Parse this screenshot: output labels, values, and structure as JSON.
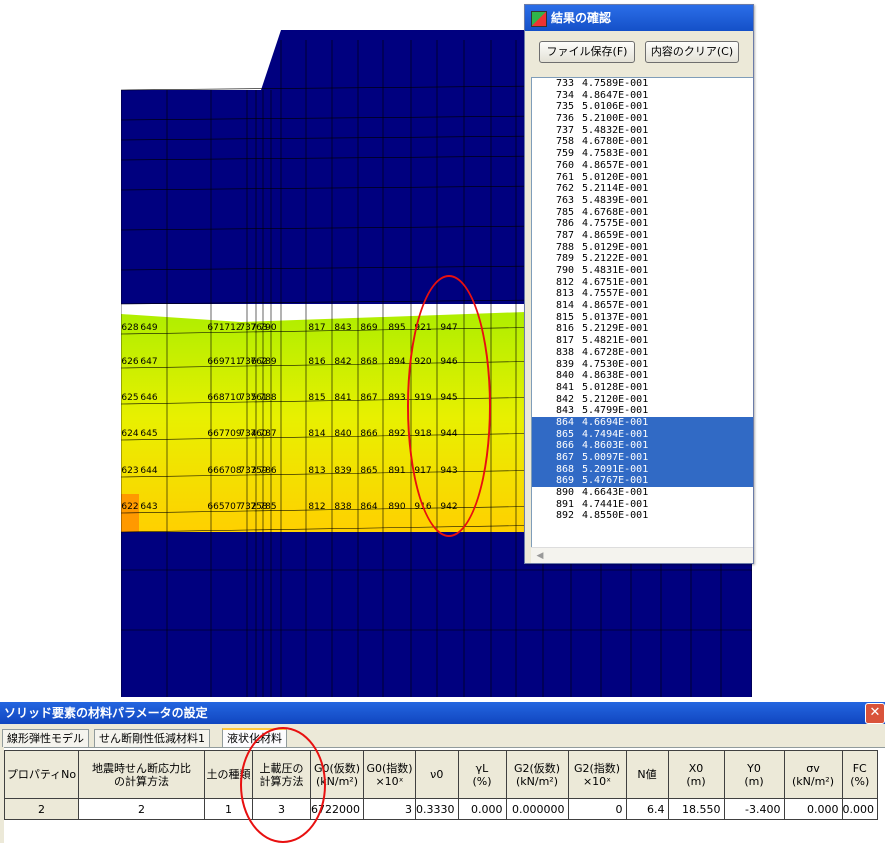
{
  "mesh": {
    "colors": {
      "navy": "#00007f",
      "band_start": "#aaee00",
      "band_end": "#ffd000",
      "orange": "#ff9900"
    },
    "visible_labels": [
      [
        "628",
        "649",
        "671",
        "712",
        "737",
        "763",
        "790",
        "817",
        "843",
        "869",
        "895",
        "921",
        "947"
      ],
      [
        "626",
        "647",
        "669",
        "711",
        "736",
        "762",
        "789",
        "816",
        "842",
        "868",
        "894",
        "920",
        "946"
      ],
      [
        "625",
        "646",
        "668",
        "710",
        "735",
        "761",
        "788",
        "815",
        "841",
        "867",
        "893",
        "919",
        "945"
      ],
      [
        "624",
        "645",
        "667",
        "709",
        "734",
        "760",
        "787",
        "814",
        "840",
        "866",
        "892",
        "918",
        "944"
      ],
      [
        "623",
        "644",
        "666",
        "708",
        "733",
        "759",
        "786",
        "813",
        "839",
        "865",
        "891",
        "917",
        "943"
      ],
      [
        "622",
        "643",
        "665",
        "707",
        "732",
        "758",
        "785",
        "812",
        "838",
        "864",
        "890",
        "916",
        "942"
      ]
    ]
  },
  "results_window": {
    "title": "結果の確認",
    "buttons": {
      "save": "ファイル保存(F)",
      "clear": "内容のクリア(C)"
    },
    "rows": [
      {
        "id": "733",
        "value": "4.7589E-001",
        "selected": false
      },
      {
        "id": "734",
        "value": "4.8647E-001",
        "selected": false
      },
      {
        "id": "735",
        "value": "5.0106E-001",
        "selected": false
      },
      {
        "id": "736",
        "value": "5.2100E-001",
        "selected": false
      },
      {
        "id": "737",
        "value": "5.4832E-001",
        "selected": false
      },
      {
        "id": "758",
        "value": "4.6780E-001",
        "selected": false
      },
      {
        "id": "759",
        "value": "4.7583E-001",
        "selected": false
      },
      {
        "id": "760",
        "value": "4.8657E-001",
        "selected": false
      },
      {
        "id": "761",
        "value": "5.0120E-001",
        "selected": false
      },
      {
        "id": "762",
        "value": "5.2114E-001",
        "selected": false
      },
      {
        "id": "763",
        "value": "5.4839E-001",
        "selected": false
      },
      {
        "id": "785",
        "value": "4.6768E-001",
        "selected": false
      },
      {
        "id": "786",
        "value": "4.7575E-001",
        "selected": false
      },
      {
        "id": "787",
        "value": "4.8659E-001",
        "selected": false
      },
      {
        "id": "788",
        "value": "5.0129E-001",
        "selected": false
      },
      {
        "id": "789",
        "value": "5.2122E-001",
        "selected": false
      },
      {
        "id": "790",
        "value": "5.4831E-001",
        "selected": false
      },
      {
        "id": "812",
        "value": "4.6751E-001",
        "selected": false
      },
      {
        "id": "813",
        "value": "4.7557E-001",
        "selected": false
      },
      {
        "id": "814",
        "value": "4.8657E-001",
        "selected": false
      },
      {
        "id": "815",
        "value": "5.0137E-001",
        "selected": false
      },
      {
        "id": "816",
        "value": "5.2129E-001",
        "selected": false
      },
      {
        "id": "817",
        "value": "5.4821E-001",
        "selected": false
      },
      {
        "id": "838",
        "value": "4.6728E-001",
        "selected": false
      },
      {
        "id": "839",
        "value": "4.7530E-001",
        "selected": false
      },
      {
        "id": "840",
        "value": "4.8638E-001",
        "selected": false
      },
      {
        "id": "841",
        "value": "5.0128E-001",
        "selected": false
      },
      {
        "id": "842",
        "value": "5.2120E-001",
        "selected": false
      },
      {
        "id": "843",
        "value": "5.4799E-001",
        "selected": false
      },
      {
        "id": "864",
        "value": "4.6694E-001",
        "selected": true
      },
      {
        "id": "865",
        "value": "4.7494E-001",
        "selected": true
      },
      {
        "id": "866",
        "value": "4.8603E-001",
        "selected": true
      },
      {
        "id": "867",
        "value": "5.0097E-001",
        "selected": true
      },
      {
        "id": "868",
        "value": "5.2091E-001",
        "selected": true
      },
      {
        "id": "869",
        "value": "5.4767E-001",
        "selected": true
      },
      {
        "id": "890",
        "value": "4.6643E-001",
        "selected": false
      },
      {
        "id": "891",
        "value": "4.7441E-001",
        "selected": false
      },
      {
        "id": "892",
        "value": "4.8550E-001",
        "selected": false
      }
    ]
  },
  "dialog": {
    "title": "ソリッド要素の材料パラメータの設定",
    "close_glyph": "✕",
    "tabs": [
      {
        "label": "線形弾性モデル",
        "active": false
      },
      {
        "label": "せん断剛性低減材料1",
        "active": false
      },
      {
        "label": "液状化材料",
        "active": true
      }
    ],
    "columns": [
      "プロパティNo",
      "地震時せん断応力比\nの計算方法",
      "土の種類",
      "上載圧の\n計算方法",
      "G0(仮数)\n(kN/m²)",
      "G0(指数)\n×10ˣ",
      "ν0",
      "γL\n(%)",
      "G2(仮数)\n(kN/m²)",
      "G2(指数)\n×10ˣ",
      "N値",
      "X0\n(m)",
      "Y0\n(m)",
      "σv\n(kN/m²)",
      "FC\n(%)"
    ],
    "row": [
      "2",
      "2",
      "1",
      "3",
      "6722000",
      "3",
      "0.3330",
      "0.000",
      "0.000000",
      "0",
      "6.4",
      "18.550",
      "-3.400",
      "0.000",
      "0.000"
    ]
  },
  "annotation_color": "#e81010"
}
